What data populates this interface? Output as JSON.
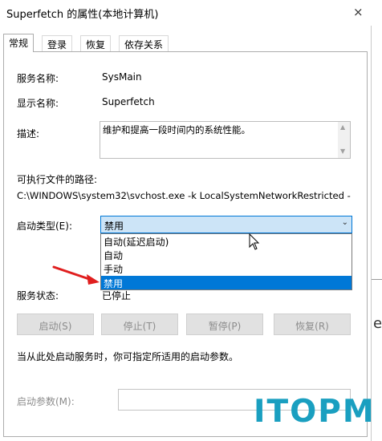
{
  "window": {
    "title": "Superfetch 的属性(本地计算机)",
    "close_label": "×"
  },
  "tabs": [
    {
      "label": "常规",
      "active": true
    },
    {
      "label": "登录"
    },
    {
      "label": "恢复"
    },
    {
      "label": "依存关系"
    }
  ],
  "general": {
    "service_name_label": "服务名称:",
    "service_name_value": "SysMain",
    "display_name_label": "显示名称:",
    "display_name_value": "Superfetch",
    "description_label": "描述:",
    "description_value": "维护和提高一段时间内的系统性能。",
    "path_label": "可执行文件的路径:",
    "path_value": "C:\\WINDOWS\\system32\\svchost.exe -k LocalSystemNetworkRestricted -",
    "startup_type_label": "启动类型(E):",
    "startup_type_value": "禁用",
    "startup_options": [
      {
        "label": "自动(延迟启动)"
      },
      {
        "label": "自动"
      },
      {
        "label": "手动"
      },
      {
        "label": "禁用",
        "selected": true
      }
    ],
    "service_status_label": "服务状态:",
    "service_status_value": "已停止",
    "buttons": {
      "start": "启动(S)",
      "stop": "停止(T)",
      "pause": "暂停(P)",
      "resume": "恢复(R)"
    },
    "hint_text": "当从此处启动服务时，你可指定所适用的启动参数。",
    "start_params_label": "启动参数(M):",
    "start_params_value": ""
  },
  "side": {
    "partial_text": "e"
  },
  "watermark": {
    "text": "ITOPM",
    "color": "#1a9fc0"
  },
  "colors": {
    "selection": "#0078d7",
    "select_bg": "#cce4f7",
    "arrow": "#e01e1e"
  }
}
